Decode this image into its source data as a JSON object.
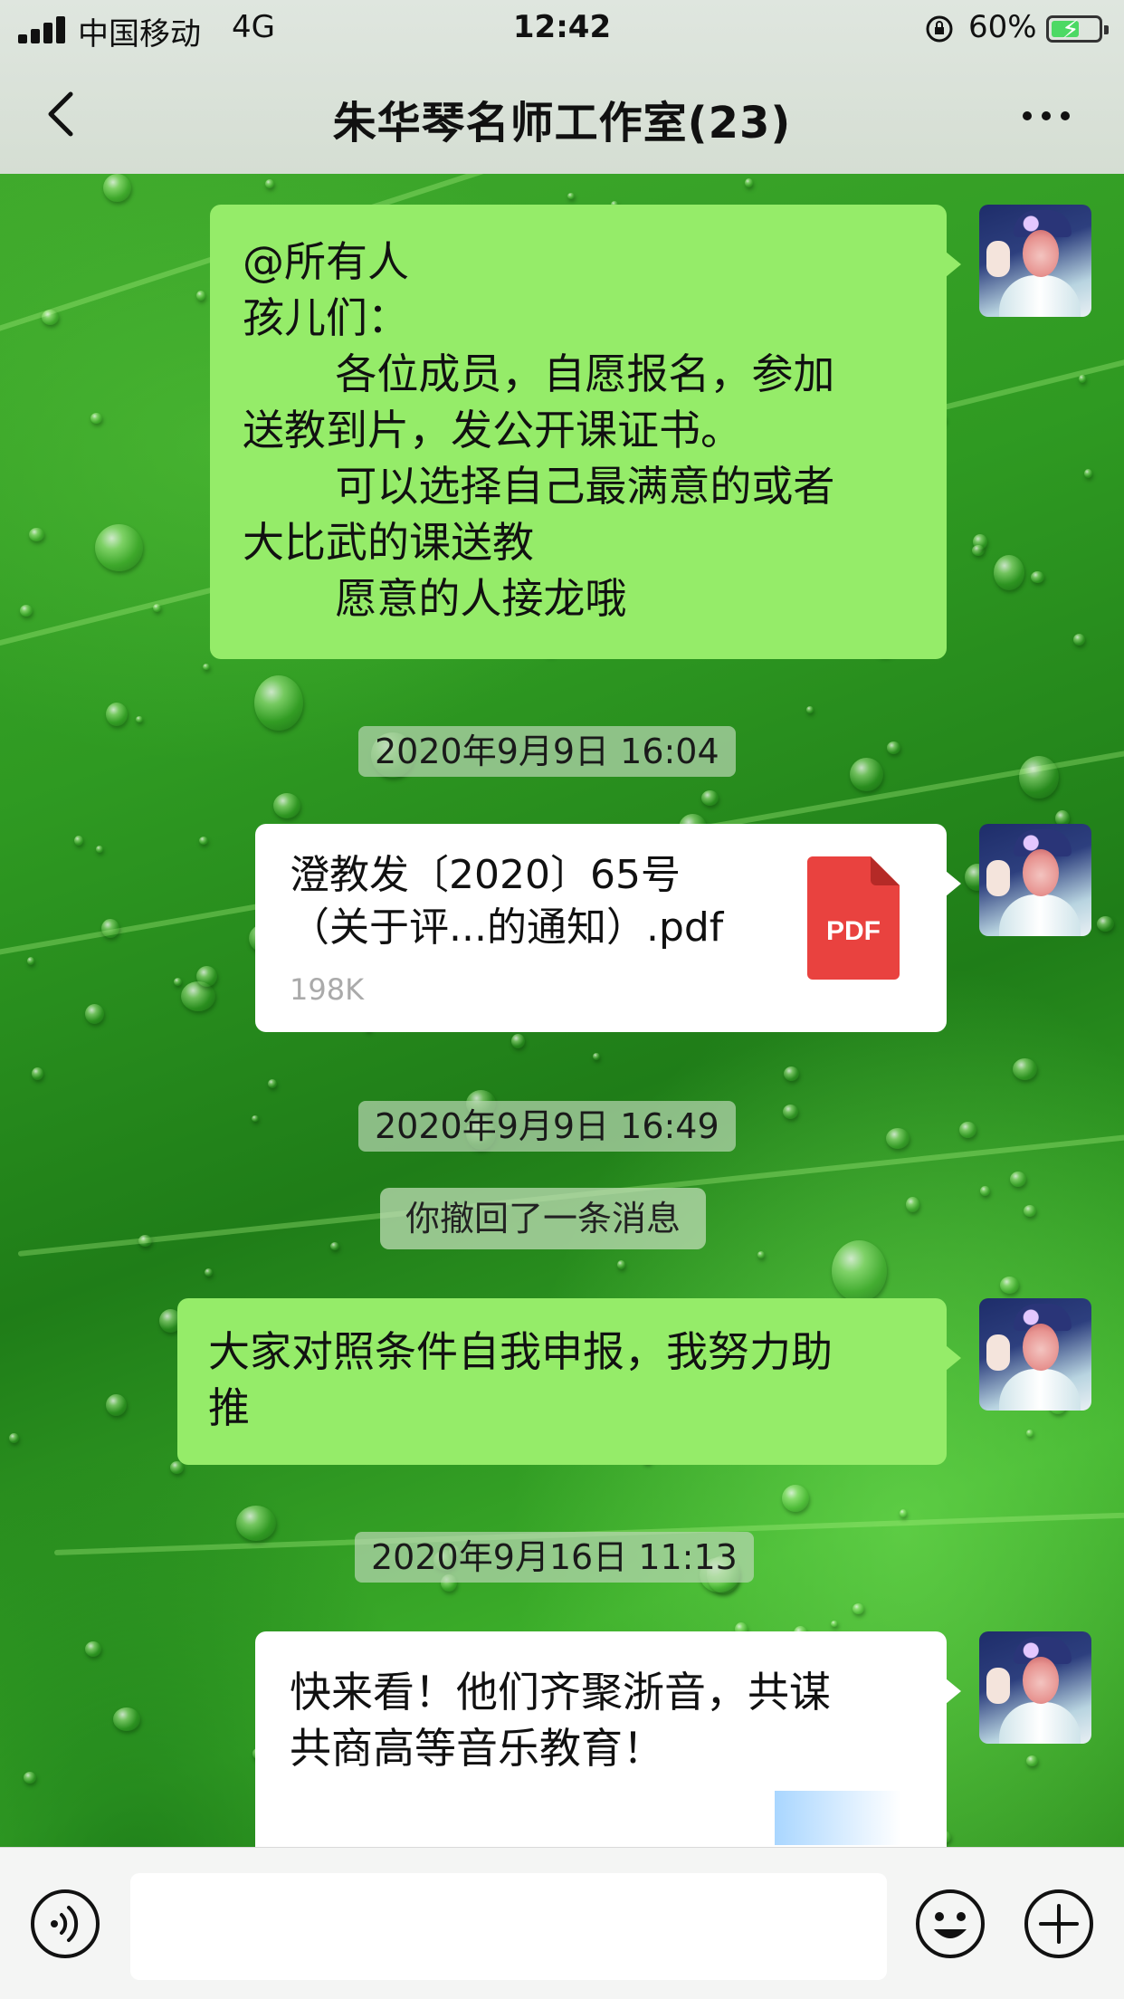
{
  "status_bar": {
    "carrier": "中国移动",
    "network": "4G",
    "time": "12:42",
    "battery": "60%",
    "battery_level": 0.6
  },
  "header": {
    "title": "朱华琴名师工作室(23)",
    "back_icon": "chevron-left-icon",
    "more_icon": "ellipsis-icon"
  },
  "messages": [
    {
      "type": "text",
      "lines": [
        "@所有人",
        "孩儿们：",
        "       各位成员，自愿报名，参加",
        "送教到片，发公开课证书。",
        "       可以选择自己最满意的或者",
        "大比武的课送教",
        "       愿意的人接龙哦"
      ]
    },
    {
      "type": "time",
      "text": "2020年9月9日 16:04"
    },
    {
      "type": "file",
      "name_lines": [
        "澄教发〔2020〕65号",
        "（关于评...的通知）.pdf"
      ],
      "size": "198K",
      "icon_label": "PDF"
    },
    {
      "type": "time",
      "text": "2020年9月9日 16:49"
    },
    {
      "type": "system",
      "text": "你撤回了一条消息"
    },
    {
      "type": "text",
      "lines": [
        "大家对照条件自我申报，我努力助",
        "推"
      ]
    },
    {
      "type": "time",
      "text": "2020年9月16日 11:13"
    },
    {
      "type": "link",
      "lines": [
        "快来看！他们齐聚浙音，共谋",
        "共商高等音乐教育！"
      ]
    }
  ],
  "input_bar": {
    "voice_icon": "voice-icon",
    "emoji_icon": "emoji-icon",
    "plus_icon": "plus-icon",
    "placeholder": ""
  },
  "colors": {
    "sent_bubble": "#95ec69",
    "card_bubble": "#ffffff",
    "pdf_red": "#e9423f",
    "battery_green": "#4cd964"
  }
}
